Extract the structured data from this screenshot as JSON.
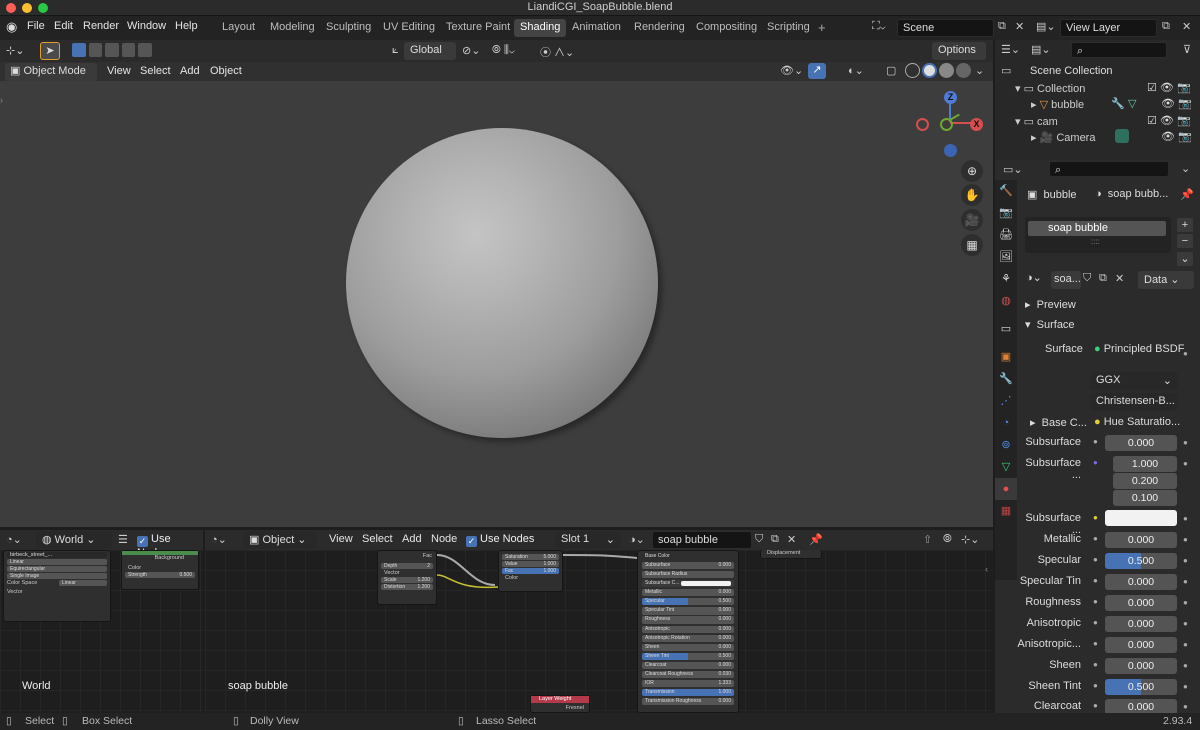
{
  "window_title": "LiandiCGI_SoapBubble.blend",
  "menu": [
    "File",
    "Edit",
    "Render",
    "Window",
    "Help"
  ],
  "workspaces": [
    "Layout",
    "Modeling",
    "Sculpting",
    "UV Editing",
    "Texture Paint",
    "Shading",
    "Animation",
    "Rendering",
    "Compositing",
    "Scripting"
  ],
  "scene": "Scene",
  "view_layer": "View Layer",
  "toolbar": {
    "transform": "Global",
    "options": "Options"
  },
  "viewport": {
    "mode": "Object Mode",
    "menu": [
      "View",
      "Select",
      "Add",
      "Object"
    ],
    "gizmo": {
      "z": "Z",
      "x": "X"
    }
  },
  "outliner": {
    "root": "Scene Collection",
    "items": [
      "Collection",
      "bubble",
      "cam",
      "Camera"
    ]
  },
  "properties": {
    "object": "bubble",
    "material_name": "soap bubb...",
    "slot": "soap bubble",
    "mat_short": "soa...",
    "data": "Data",
    "preview": "Preview",
    "surface_panel": "Surface",
    "surface_label": "Surface",
    "surface_value": "Principled BSDF",
    "distribution": "GGX",
    "subsurface_method": "Christensen-B...",
    "base_color_label": "Base C...",
    "base_color_value": "Hue Saturatio...",
    "rows": [
      {
        "label": "Subsurface",
        "value": "0.000"
      },
      {
        "label": "Subsurface ...",
        "value": "1.000"
      },
      {
        "label": "",
        "value": "0.200"
      },
      {
        "label": "",
        "value": "0.100"
      },
      {
        "label": "Subsurface ...",
        "value": ""
      },
      {
        "label": "Metallic",
        "value": "0.000"
      },
      {
        "label": "Specular",
        "value": "0.500"
      },
      {
        "label": "Specular Tin",
        "value": "0.000"
      },
      {
        "label": "Roughness",
        "value": "0.000"
      },
      {
        "label": "Anisotropic",
        "value": "0.000"
      },
      {
        "label": "Anisotropic...",
        "value": "0.000"
      },
      {
        "label": "Sheen",
        "value": "0.000"
      },
      {
        "label": "Sheen Tint",
        "value": "0.500"
      },
      {
        "label": "Clearcoat",
        "value": "0.000"
      }
    ]
  },
  "world_editor": {
    "type": "World",
    "use_nodes": "Use Nodes",
    "label": "World",
    "image": "birbeck_street_...",
    "interp": "Linear",
    "proj": "Equirectangular",
    "src": "Single Image",
    "color_space_label": "Color Space",
    "color_space": "Linear",
    "vector": "Vector",
    "bg_node": {
      "title": "Background",
      "color": "Color",
      "strength": "Strength",
      "strength_value": "0.500"
    }
  },
  "shader_editor": {
    "object": "Object",
    "menu": [
      "View",
      "Select",
      "Add",
      "Node"
    ],
    "use_nodes": "Use Nodes",
    "slot": "Slot 1",
    "material": "soap bubble",
    "label": "soap bubble"
  },
  "nodes": {
    "tex": {
      "fac": "Fac",
      "depth": "Depth",
      "depth_v": "2",
      "vector": "Vector",
      "scale": "Scale",
      "scale_v": "1.200",
      "distortion": "Distortion",
      "distortion_v": "1.200"
    },
    "hsv": {
      "sat": "Saturation",
      "sat_v": "5.000",
      "val": "Value",
      "val_v": "1.000",
      "fac": "Fac",
      "fac_v": "1.000",
      "color": "Color"
    },
    "bsdf": [
      "Base Color",
      "Subsurface",
      "Subsurface Radius",
      "Subsurface C...",
      "Metallic",
      "Specular",
      "Specular Tint",
      "Roughness",
      "Anisotropic",
      "Anisotropic Rotation",
      "Sheen",
      "Sheen Tint",
      "Clearcoat",
      "Clearcoat Roughness",
      "IOR",
      "Transmission",
      "Transmission Roughness"
    ],
    "bsdf_vals": [
      "",
      "0.000",
      "",
      "",
      "0.000",
      "0.500",
      "0.000",
      "0.000",
      "0.000",
      "0.000",
      "0.000",
      "0.500",
      "0.000",
      "0.030",
      "1.333",
      "1.000",
      "0.000"
    ],
    "output": "Displacement",
    "layer_weight": "Layer Weight",
    "fresnel": "Fresnel"
  },
  "statusbar": {
    "select": "Select",
    "box": "Box Select",
    "dolly": "Dolly View",
    "lasso": "Lasso Select",
    "version": "2.93.4"
  },
  "colors": {
    "accent": "#4772b3",
    "header": "#2b2b2b",
    "viewport": "#3d3d3d"
  }
}
